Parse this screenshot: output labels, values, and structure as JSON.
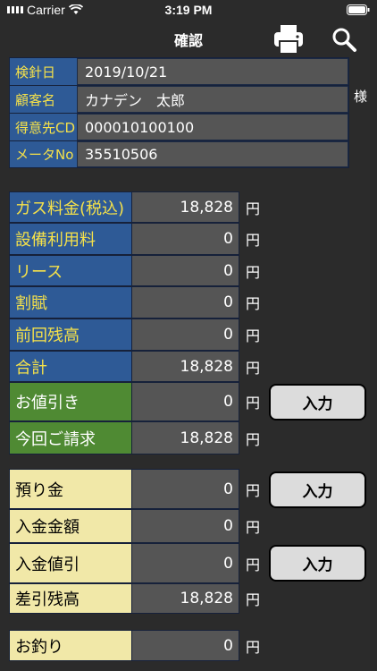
{
  "status": {
    "carrier": "Carrier",
    "time": "3:19 PM"
  },
  "nav": {
    "title": "確認",
    "print_icon": "printer-icon",
    "search_icon": "search-icon"
  },
  "info": {
    "rows": [
      {
        "label": "検針日",
        "value": "2019/10/21"
      },
      {
        "label": "顧客名",
        "value": "カナデン　太郎"
      },
      {
        "label": "得意先CD",
        "value": "000010100100"
      },
      {
        "label": "メータNo",
        "value": "35510506"
      }
    ],
    "honorific": "様"
  },
  "charges": {
    "unit": "円",
    "rows": [
      {
        "label": "ガス料金(税込)",
        "value": "18,828"
      },
      {
        "label": "設備利用料",
        "value": "0"
      },
      {
        "label": "リース",
        "value": "0"
      },
      {
        "label": "割賦",
        "value": "0"
      },
      {
        "label": "前回残高",
        "value": "0"
      },
      {
        "label": "合計",
        "value": "18,828"
      },
      {
        "label": "お値引き",
        "value": "0"
      },
      {
        "label": "今回ご請求",
        "value": "18,828"
      }
    ]
  },
  "payments": {
    "rows": [
      {
        "label": "預り金",
        "value": "0"
      },
      {
        "label": "入金金額",
        "value": "0"
      },
      {
        "label": "入金値引",
        "value": "0"
      },
      {
        "label": "差引残高",
        "value": "18,828"
      }
    ]
  },
  "change": {
    "label": "お釣り",
    "value": "0"
  },
  "buttons": {
    "input_label": "入力"
  },
  "colors": {
    "label_blue": "#2e5a96",
    "label_green": "#4f8a33",
    "label_cream": "#f1e8a8",
    "label_text": "#f5e14a",
    "value_bg": "#555555"
  }
}
